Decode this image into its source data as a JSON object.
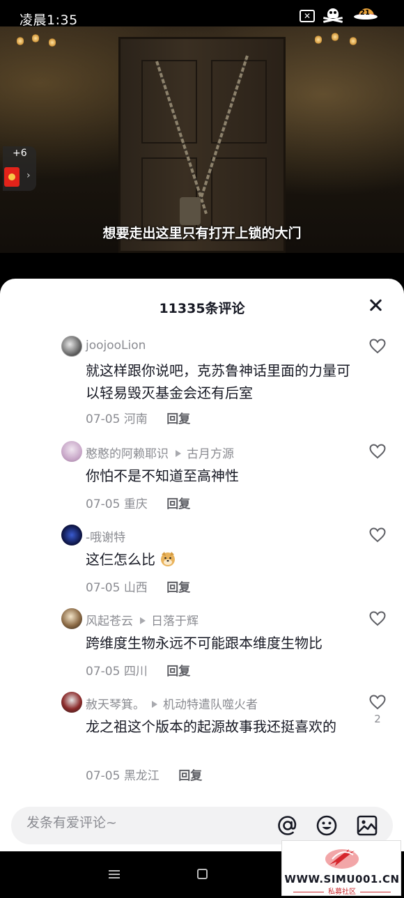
{
  "status_bar": {
    "time": "凌晨1:35",
    "battery_level": "21"
  },
  "video": {
    "subtitle": "想要走出这里只有打开上锁的大门",
    "redpack": {
      "count": "+6",
      "chevron": "›"
    }
  },
  "comments_panel": {
    "title": "11335条评论",
    "comments": [
      {
        "author": "joojooLion",
        "reply_to": "",
        "text": "就这样跟你说吧，克苏鲁神话里面的力量可以轻易毁灭基金会还有后室",
        "date": "07-05",
        "location": "河南",
        "reply_label": "回复",
        "likes": ""
      },
      {
        "author": "憨憨的阿赖耶识",
        "reply_to": "古月方源",
        "text": "你怕不是不知道至高神性",
        "date": "07-05",
        "location": "重庆",
        "reply_label": "回复",
        "likes": ""
      },
      {
        "author": "-哦谢特",
        "reply_to": "",
        "text": "这仨怎么比",
        "date": "07-05",
        "location": "山西",
        "reply_label": "回复",
        "likes": ""
      },
      {
        "author": "风起苍云",
        "reply_to": "日落于辉",
        "text": "跨维度生物永远不可能跟本维度生物比",
        "date": "07-05",
        "location": "四川",
        "reply_label": "回复",
        "likes": ""
      },
      {
        "author": "赦天琴箕。",
        "reply_to": "机动特遣队噬火者",
        "text": "龙之祖这个版本的起源故事我还挺喜欢的",
        "date": "07-05",
        "location": "黑龙江",
        "reply_label": "回复",
        "likes": "2"
      }
    ],
    "input": {
      "placeholder": "发条有爱评论~"
    }
  },
  "watermark": {
    "url": "WWW.SIMU001.CN",
    "subtitle": "私募社区"
  }
}
